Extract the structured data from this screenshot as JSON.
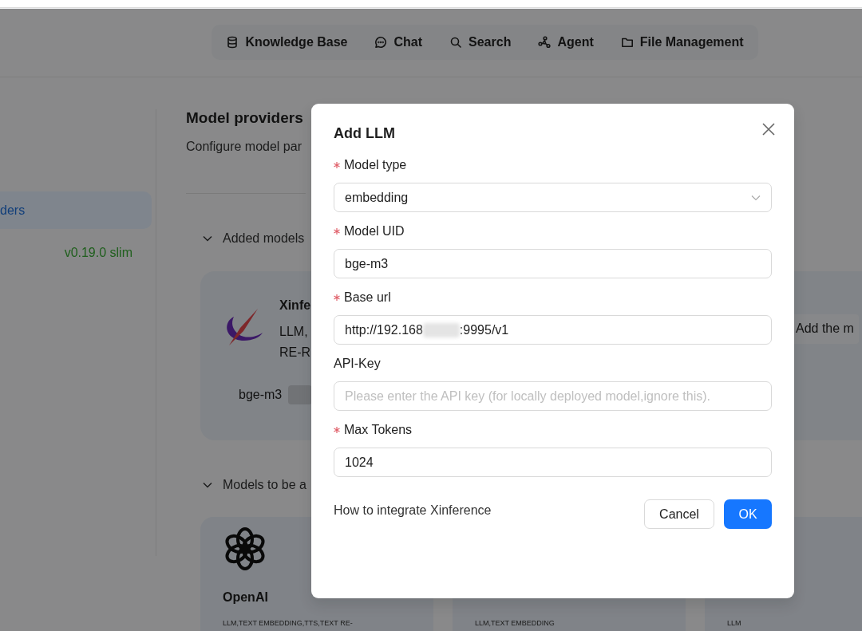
{
  "nav": [
    {
      "label": "Knowledge Base"
    },
    {
      "label": "Chat"
    },
    {
      "label": "Search"
    },
    {
      "label": "Agent"
    },
    {
      "label": "File Management"
    }
  ],
  "sidebar": {
    "items": [
      {
        "label": "ders",
        "selected": true
      }
    ],
    "version": "v0.19.0 slim"
  },
  "main": {
    "title": "Model providers",
    "subtitle": "Configure model par",
    "added": {
      "heading": "Added models",
      "card": {
        "name": "Xinfe",
        "tags_line_1": "LLM,",
        "tags_line_2": "RE-R",
        "model": "bge-m3",
        "add_button": "Add the m"
      }
    },
    "available": {
      "heading": "Models to be a",
      "cards": [
        {
          "name": "OpenAI",
          "tags": "LLM,TEXT EMBEDDING,TTS,TEXT RE-"
        },
        {
          "tags": "LLM,TEXT EMBEDDING"
        },
        {
          "tags": "LLM"
        }
      ]
    }
  },
  "dialog": {
    "title": "Add LLM",
    "fields": [
      {
        "kind": "select",
        "label": "Model type",
        "required": true,
        "value": "embedding"
      },
      {
        "kind": "input",
        "label": "Model UID",
        "required": true,
        "value": "bge-m3"
      },
      {
        "kind": "redacted",
        "label": "Base url",
        "required": true,
        "value_start": "http://192.168",
        "value_end": ":9995/v1"
      },
      {
        "kind": "input",
        "label": "API-Key",
        "required": false,
        "placeholder": "Please enter the API key (for locally deployed model,ignore this)."
      },
      {
        "kind": "input",
        "label": "Max Tokens",
        "required": true,
        "value": "1024"
      }
    ],
    "help_link": "How to integrate Xinference",
    "buttons": [
      {
        "label": "Cancel",
        "primary": false
      },
      {
        "label": "OK",
        "primary": true
      }
    ]
  }
}
